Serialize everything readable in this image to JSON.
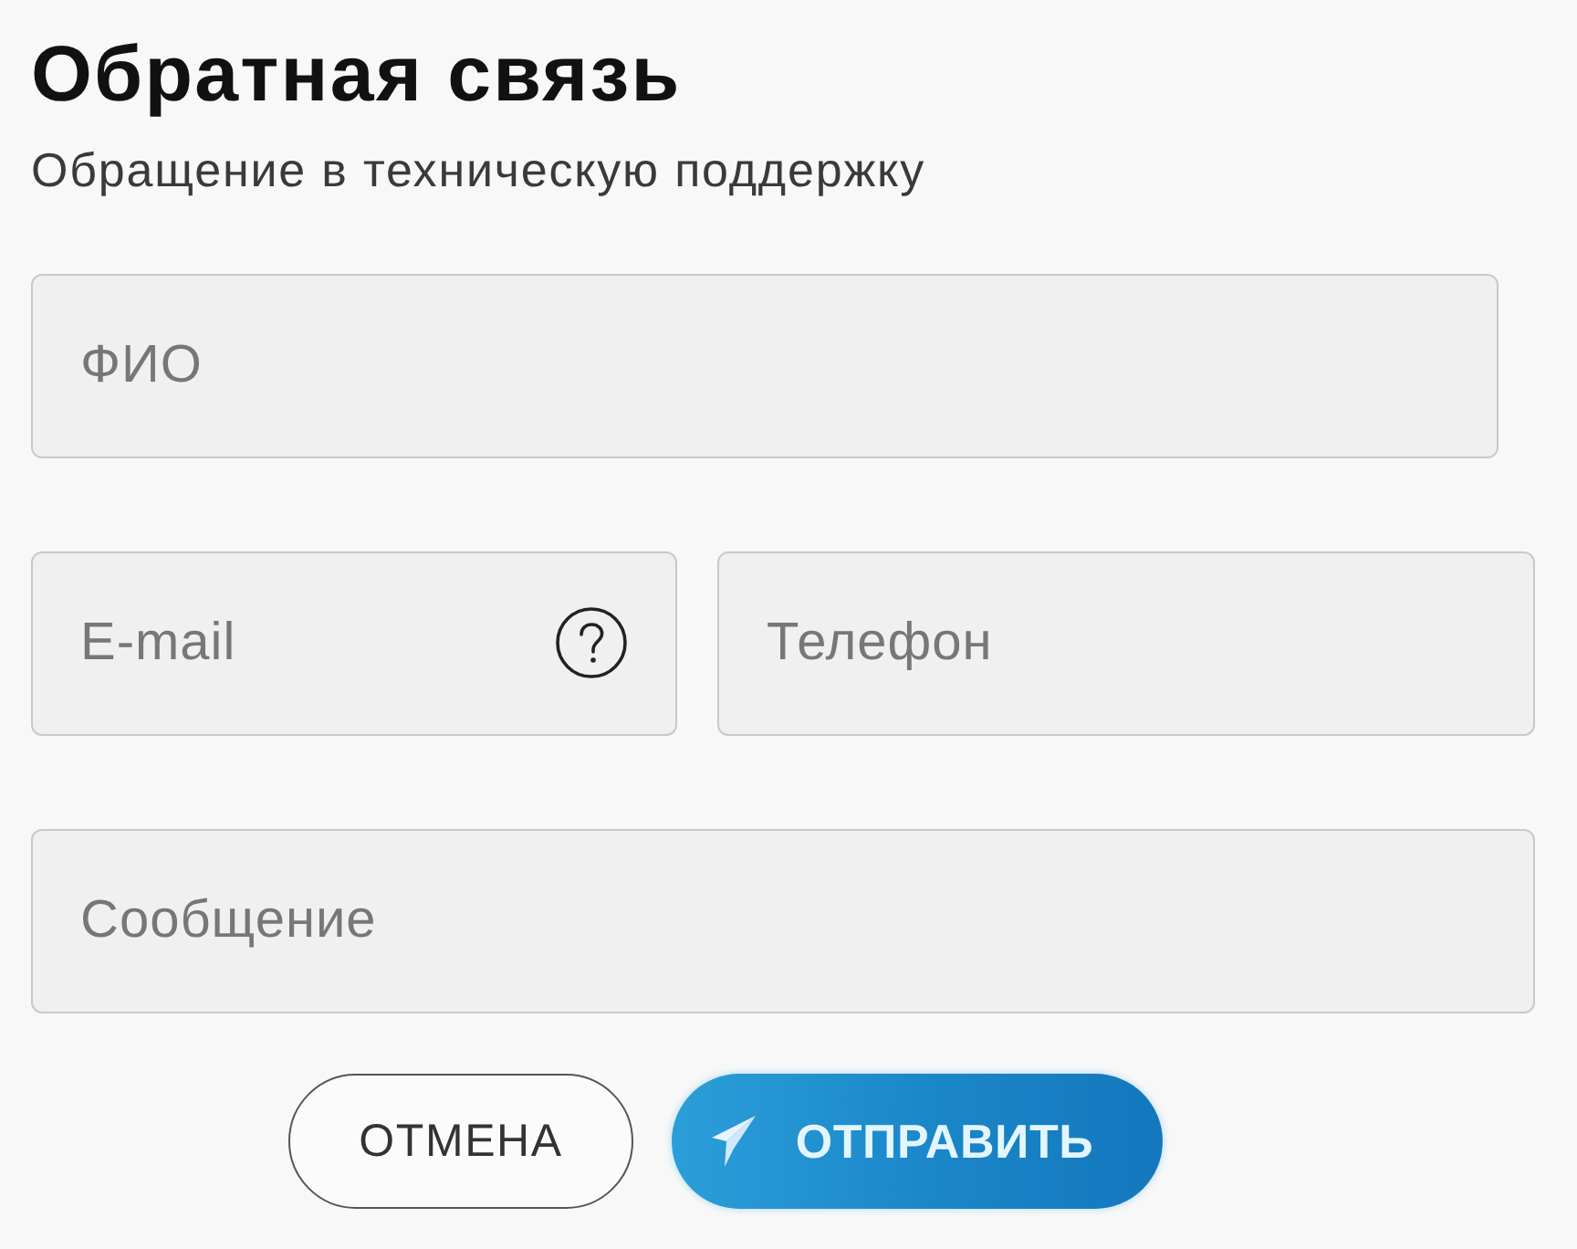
{
  "header": {
    "title": "Обратная связь",
    "subtitle": "Обращение в техническую поддержку"
  },
  "form": {
    "rows": [
      [
        {
          "placeholder": "ФИО",
          "help": false
        }
      ],
      [
        {
          "placeholder": "E-mail",
          "help": true
        },
        {
          "placeholder": "Телефон",
          "help": false
        }
      ],
      [
        {
          "placeholder": "Сообщение",
          "help": false
        }
      ]
    ]
  },
  "buttons": [
    {
      "label": "ОТМЕНА",
      "kind": "secondary"
    },
    {
      "label": "ОТПРАВИТЬ",
      "kind": "primary"
    }
  ]
}
